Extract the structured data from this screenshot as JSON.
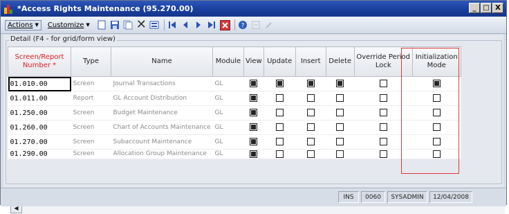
{
  "window": {
    "title": "*Access Rights Maintenance (95.270.00)",
    "controls": [
      "_",
      "□",
      "X"
    ]
  },
  "toolbar": {
    "actions_label": "Actions",
    "customize_label": "Customize",
    "icons": [
      "new-icon",
      "save-icon",
      "copy-icon",
      "delete-icon",
      "cancel-icon",
      "first-icon",
      "previous-icon",
      "next-icon",
      "last-icon",
      "close-icon",
      "help-icon",
      "note-icon",
      "attachment-icon"
    ]
  },
  "detail": {
    "group_label": "Detail (F4 - for grid/form view)"
  },
  "grid": {
    "columns": [
      "Screen/Report Number *",
      "Type",
      "Name",
      "Module",
      "View",
      "Update",
      "Insert",
      "Delete",
      "Override Period Lock",
      "Initialization Mode"
    ],
    "rows": [
      {
        "number": "01.010.00",
        "type": "Screen",
        "name": "Journal Transactions",
        "module": "GL",
        "view": true,
        "update": true,
        "insert": true,
        "delete": true,
        "override": false,
        "init": true
      },
      {
        "number": "01.011.00",
        "type": "Report",
        "name": "GL Account Distribution",
        "module": "GL",
        "view": true,
        "update": false,
        "insert": false,
        "delete": false,
        "override": false,
        "init": false
      },
      {
        "number": "01.250.00",
        "type": "Screen",
        "name": "Budget Maintenance",
        "module": "GL",
        "view": true,
        "update": false,
        "insert": false,
        "delete": false,
        "override": false,
        "init": false
      },
      {
        "number": "01.260.00",
        "type": "Screen",
        "name": "Chart of Accounts Maintenance",
        "module": "GL",
        "view": true,
        "update": false,
        "insert": false,
        "delete": false,
        "override": false,
        "init": false
      },
      {
        "number": "01.270.00",
        "type": "Screen",
        "name": "Subaccount Maintenance",
        "module": "GL",
        "view": true,
        "update": false,
        "insert": false,
        "delete": false,
        "override": false,
        "init": false
      },
      {
        "number": "01.290.00",
        "type": "Screen",
        "name": "Allocation Group Maintenance",
        "module": "GL",
        "view": true,
        "update": false,
        "insert": false,
        "delete": false,
        "override": false,
        "init": false
      }
    ]
  },
  "status": {
    "mode": "INS",
    "company": "0060",
    "user": "SYSADMIN",
    "date": "12/04/2008"
  },
  "colors": {
    "title_bar": "#1a3f9e",
    "highlight_border": "#dd3a3a",
    "required_header": "#e02020"
  }
}
